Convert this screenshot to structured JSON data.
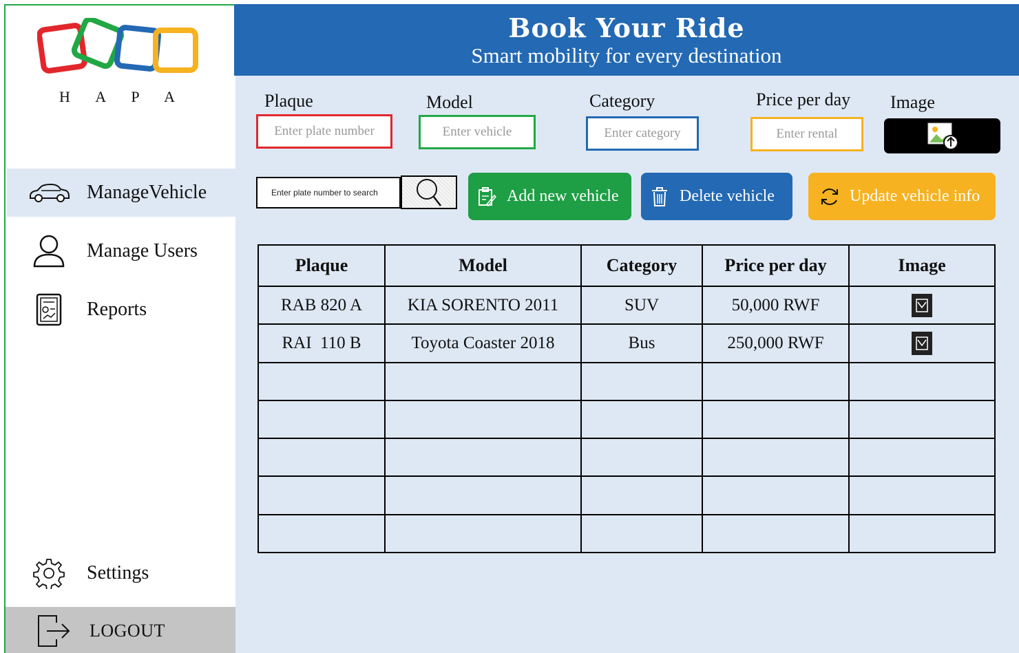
{
  "brand": {
    "logo_text": "H A P A",
    "colors": [
      "#e2272c",
      "#22a745",
      "#2369b3",
      "#f6b221"
    ]
  },
  "header": {
    "title": "Book Your Ride",
    "subtitle": "Smart mobility for every destination"
  },
  "sidebar": {
    "items": [
      {
        "label": "ManageVehicle",
        "icon": "car-icon",
        "active": true
      },
      {
        "label": "Manage Users",
        "icon": "user-icon",
        "active": false
      },
      {
        "label": "Reports",
        "icon": "report-icon",
        "active": false
      }
    ],
    "settings_label": "Settings",
    "logout_label": "LOGOUT"
  },
  "form": {
    "plaque": {
      "label": "Plaque",
      "placeholder": "Enter plate number",
      "border": "#e2272c"
    },
    "model": {
      "label": "Model",
      "placeholder": "Enter vehicle",
      "border": "#22a745"
    },
    "category": {
      "label": "Category",
      "placeholder": "Enter category",
      "border": "#2369b3"
    },
    "price": {
      "label": "Price per day",
      "placeholder": "Enter rental",
      "border": "#f6b221"
    },
    "image": {
      "label": "Image",
      "icon": "image-upload-icon"
    }
  },
  "search": {
    "placeholder": "Enter plate number to search",
    "icon": "search-icon"
  },
  "actions": {
    "add": {
      "label": "Add new vehicle",
      "icon": "edit-icon",
      "color": "#1e9e45"
    },
    "delete": {
      "label": "Delete vehicle",
      "icon": "trash-icon",
      "color": "#2369b3"
    },
    "update": {
      "label": "Update vehicle info",
      "icon": "refresh-icon",
      "color": "#f6b221"
    }
  },
  "table": {
    "columns": [
      "Plaque",
      "Model",
      "Category",
      "Price per day",
      "Image"
    ],
    "rows": [
      [
        "RAB 820 A",
        "KIA SORENTO 2011",
        "SUV",
        "50,000 RWF",
        "image-thumbnail-icon"
      ],
      [
        "RAI  110 B",
        "Toyota Coaster 2018",
        "Bus",
        "250,000 RWF",
        "image-thumbnail-icon"
      ],
      [
        "",
        "",
        "",
        "",
        ""
      ],
      [
        "",
        "",
        "",
        "",
        ""
      ],
      [
        "",
        "",
        "",
        "",
        ""
      ],
      [
        "",
        "",
        "",
        "",
        ""
      ],
      [
        "",
        "",
        "",
        "",
        ""
      ]
    ]
  }
}
